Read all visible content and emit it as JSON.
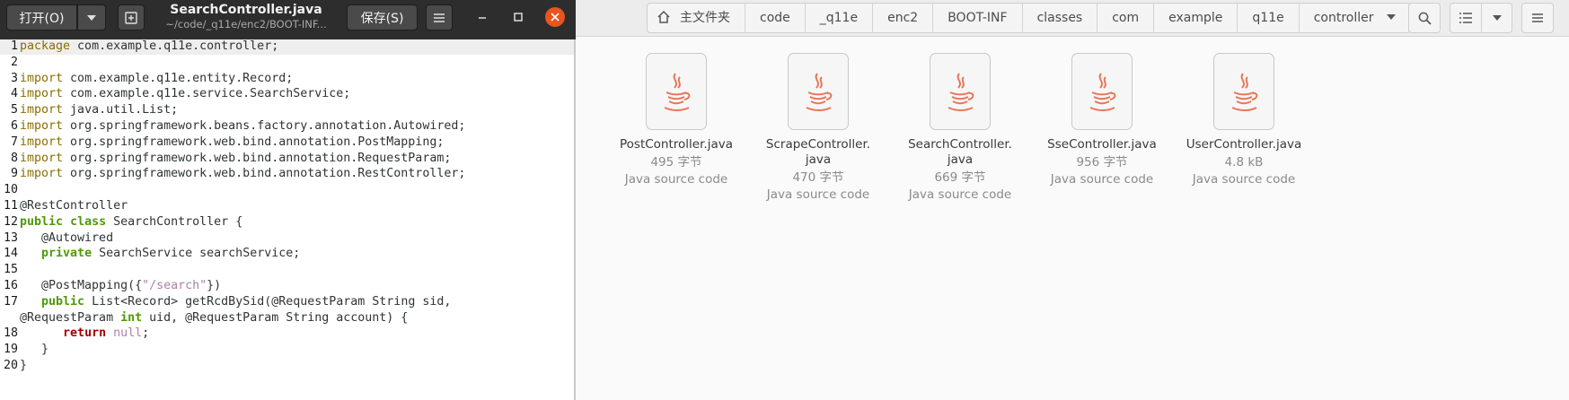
{
  "editor": {
    "open_label": "打开(O)",
    "save_label": "保存(S)",
    "title": "SearchController.java",
    "subtitle": "~/code/_q11e/enc2/BOOT-INF...",
    "lines": [
      {
        "n": "1",
        "tokens": [
          {
            "c": "kw",
            "t": "package"
          },
          {
            "c": "",
            "t": " com.example.q11e.controller;"
          }
        ]
      },
      {
        "n": "2",
        "tokens": []
      },
      {
        "n": "3",
        "tokens": [
          {
            "c": "kw",
            "t": "import"
          },
          {
            "c": "",
            "t": " com.example.q11e.entity.Record;"
          }
        ]
      },
      {
        "n": "4",
        "tokens": [
          {
            "c": "kw",
            "t": "import"
          },
          {
            "c": "",
            "t": " com.example.q11e.service.SearchService;"
          }
        ]
      },
      {
        "n": "5",
        "tokens": [
          {
            "c": "kw",
            "t": "import"
          },
          {
            "c": "",
            "t": " java.util.List;"
          }
        ]
      },
      {
        "n": "6",
        "tokens": [
          {
            "c": "kw",
            "t": "import"
          },
          {
            "c": "",
            "t": " org.springframework.beans.factory.annotation.Autowired;"
          }
        ]
      },
      {
        "n": "7",
        "tokens": [
          {
            "c": "kw",
            "t": "import"
          },
          {
            "c": "",
            "t": " org.springframework.web.bind.annotation.PostMapping;"
          }
        ]
      },
      {
        "n": "8",
        "tokens": [
          {
            "c": "kw",
            "t": "import"
          },
          {
            "c": "",
            "t": " org.springframework.web.bind.annotation.RequestParam;"
          }
        ]
      },
      {
        "n": "9",
        "tokens": [
          {
            "c": "kw",
            "t": "import"
          },
          {
            "c": "",
            "t": " org.springframework.web.bind.annotation.RestController;"
          }
        ]
      },
      {
        "n": "10",
        "tokens": []
      },
      {
        "n": "11",
        "tokens": [
          {
            "c": "",
            "t": "@RestController"
          }
        ]
      },
      {
        "n": "12",
        "tokens": [
          {
            "c": "kw2",
            "t": "public"
          },
          {
            "c": "",
            "t": " "
          },
          {
            "c": "kw2",
            "t": "class"
          },
          {
            "c": "",
            "t": " SearchController {"
          }
        ]
      },
      {
        "n": "13",
        "tokens": [
          {
            "c": "",
            "t": "   @Autowired"
          }
        ]
      },
      {
        "n": "14",
        "tokens": [
          {
            "c": "",
            "t": "   "
          },
          {
            "c": "kw2",
            "t": "private"
          },
          {
            "c": "",
            "t": " SearchService searchService;"
          }
        ]
      },
      {
        "n": "15",
        "tokens": []
      },
      {
        "n": "16",
        "tokens": [
          {
            "c": "",
            "t": "   @PostMapping({"
          },
          {
            "c": "str",
            "t": "\"/search\""
          },
          {
            "c": "",
            "t": "})"
          }
        ]
      },
      {
        "n": "17",
        "tokens": [
          {
            "c": "",
            "t": "   "
          },
          {
            "c": "kw2",
            "t": "public"
          },
          {
            "c": "",
            "t": " List<Record> getRcdBySid(@RequestParam String sid,"
          }
        ]
      },
      {
        "n": "",
        "tokens": [
          {
            "c": "",
            "t": "@RequestParam "
          },
          {
            "c": "kw2",
            "t": "int"
          },
          {
            "c": "",
            "t": " uid, @RequestParam String account) {"
          }
        ]
      },
      {
        "n": "18",
        "tokens": [
          {
            "c": "",
            "t": "      "
          },
          {
            "c": "kr",
            "t": "return"
          },
          {
            "c": "",
            "t": " "
          },
          {
            "c": "nul",
            "t": "null"
          },
          {
            "c": "",
            "t": ";"
          }
        ]
      },
      {
        "n": "19",
        "tokens": [
          {
            "c": "",
            "t": "   }"
          }
        ]
      },
      {
        "n": "20",
        "tokens": [
          {
            "c": "",
            "t": "}"
          }
        ]
      }
    ]
  },
  "filemanager": {
    "breadcrumbs": [
      "主文件夹",
      "code",
      "_q11e",
      "enc2",
      "BOOT-INF",
      "classes",
      "com",
      "example",
      "q11e",
      "controller"
    ],
    "files": [
      {
        "name": "PostController.java",
        "size": "495 字节",
        "type": "Java source code"
      },
      {
        "name": "ScrapeController.\njava",
        "size": "470 字节",
        "type": "Java source code"
      },
      {
        "name": "SearchController.\njava",
        "size": "669 字节",
        "type": "Java source code"
      },
      {
        "name": "SseController.java",
        "size": "956 字节",
        "type": "Java source code"
      },
      {
        "name": "UserController.java",
        "size": "4.8 kB",
        "type": "Java source code"
      }
    ]
  },
  "colors": {
    "editor_header": "#2d2d2d",
    "close_button": "#e9541f",
    "java_icon": "#e8765a"
  }
}
